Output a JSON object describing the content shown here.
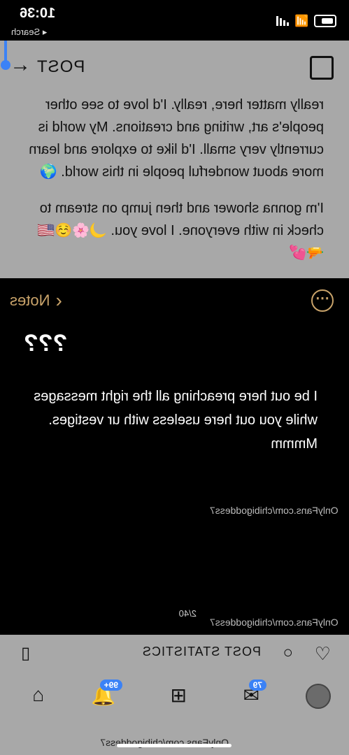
{
  "status_bar": {
    "time": "10:36",
    "back_label": "◂ Search"
  },
  "header": {
    "title": "POST",
    "back_icon": "arrow-left",
    "share_icon": "share-icon"
  },
  "post": {
    "paragraph_1": "really matter here, really. I'd love to see other people's art, writing and creations. My world is currently very small. I'd like to explore and learn more about wonderful people in this world. 🌍",
    "paragraph_2": "I'm gonna shower and then jump on stream to check in with everyone. I love you. 🌙🌸☺️🇺🇸 🔫💕"
  },
  "note": {
    "back_label": "Notes",
    "title": "???",
    "body": "I be out here preaching all the right messages while you out here useless with ur vestiges. Mmmm",
    "watermark_1": "OnlyFans.com/chibigoddess7",
    "watermark_2": "OnlyFans.com/chibigoddess7",
    "page_indicator": "2/40"
  },
  "actions": {
    "stats_label": "POST STATISTICS"
  },
  "tabbar": {
    "messages_badge": "79",
    "notifications_badge": "99+",
    "bottom_watermark": "OnlyFans.com/chibigoddess7"
  }
}
